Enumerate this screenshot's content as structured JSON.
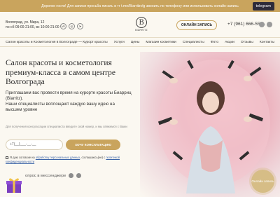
{
  "topbar": {
    "text": "Дорогие гости! Для записи просьба писать в тг t.me/Biarritzvlg звонить по телефону или использовать онлайн-запись",
    "telegram_label": "telegram"
  },
  "header": {
    "address_line1": "Волгоград, ул. Мира, 12",
    "address_line2": "пн-сб 09:00-21:00, вс 10:00-21:00",
    "logo_mark": "B",
    "logo_text": "BIARRITZ",
    "signup_label": "ОНЛАЙН ЗАПИСЬ",
    "phone": "+7 (961) 666-55-..."
  },
  "nav": {
    "items": [
      "Салон красоты и Косметология в Волгограде — Курорт красоты",
      "Услуги",
      "Цены",
      "Магазин косметики",
      "Специалисты",
      "Фото",
      "Акции",
      "Отзывы",
      "Контакты"
    ]
  },
  "hero": {
    "title": "Салон красоты и косметология премиум-класса в самом центре Волгограда",
    "text_line1": "Приглашаем вас провести время на курорте красоты Биарриц (Biarritz).",
    "text_line2": "Наши специалисты воплощают каждую вашу идею на высшем уровне",
    "note": "Для получения консультации специалиста введите свой номер, и мы свяжемся с Вами"
  },
  "form": {
    "phone_value": "+7(__)___-__-__",
    "consult_label": "ХОЧУ КОНСУЛЬТАЦИЮ",
    "consent_prefix": "Я даю согласие на ",
    "consent_link1": "обработку персональных данных",
    "consent_mid": ", соглашаюсь(не) с ",
    "consent_link2": "политикой конфиденциальности"
  },
  "messenger": {
    "label": "опрос в мессенджере"
  },
  "fab": {
    "label": "Онлайн запись"
  },
  "colors": {
    "accent": "#c9a45d",
    "dark_button": "#2d2b3a",
    "background": "#fbf8f1",
    "hero_pink": "#ecb1bd"
  }
}
